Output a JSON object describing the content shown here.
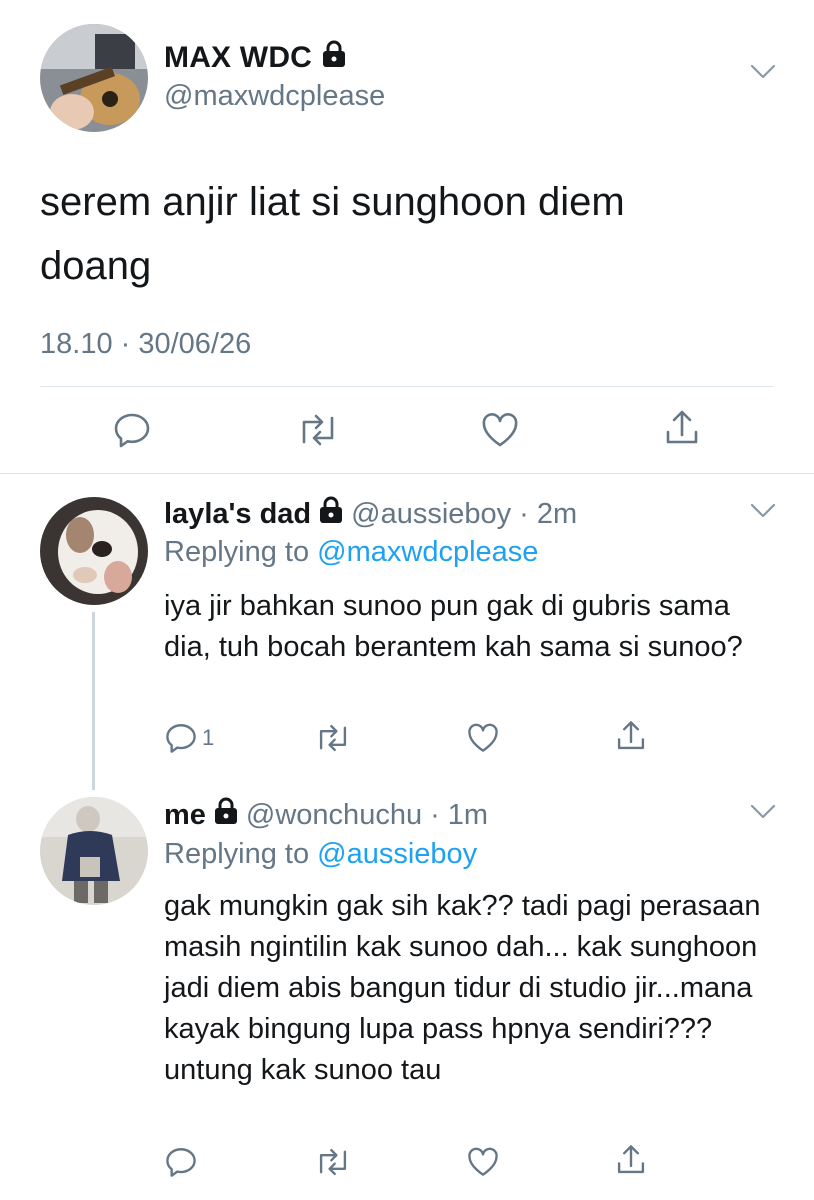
{
  "main_tweet": {
    "display_name": "MAX WDC",
    "handle": "@maxwdcplease",
    "text": "serem anjir liat si sunghoon diem doang",
    "timestamp": "18.10 · 30/06/26",
    "icons": [
      "reply-icon",
      "retweet-icon",
      "like-icon",
      "share-icon"
    ]
  },
  "replies": [
    {
      "display_name": "layla's dad",
      "handle": "@aussieboy",
      "time": "· 2m",
      "replying_prefix": "Replying to ",
      "replying_to": "@maxwdcplease",
      "text": "iya jir bahkan sunoo pun gak di gubris sama dia, tuh bocah berantem kah sama si sunoo?",
      "reply_count": "1"
    },
    {
      "display_name": "me",
      "handle": "@wonchuchu",
      "time": "· 1m",
      "replying_prefix": "Replying to ",
      "replying_to": "@aussieboy",
      "text": "gak mungkin gak sih kak?? tadi pagi perasaan masih ngintilin kak sunoo dah... kak sunghoon jadi diem abis bangun tidur di studio jir...mana kayak bingung lupa pass hpnya sendiri??? untung kak sunoo tau",
      "reply_count": ""
    }
  ],
  "colors": {
    "text": "#14171a",
    "secondary": "#657786",
    "link": "#1da1f2",
    "divider": "#e1e8ed"
  }
}
